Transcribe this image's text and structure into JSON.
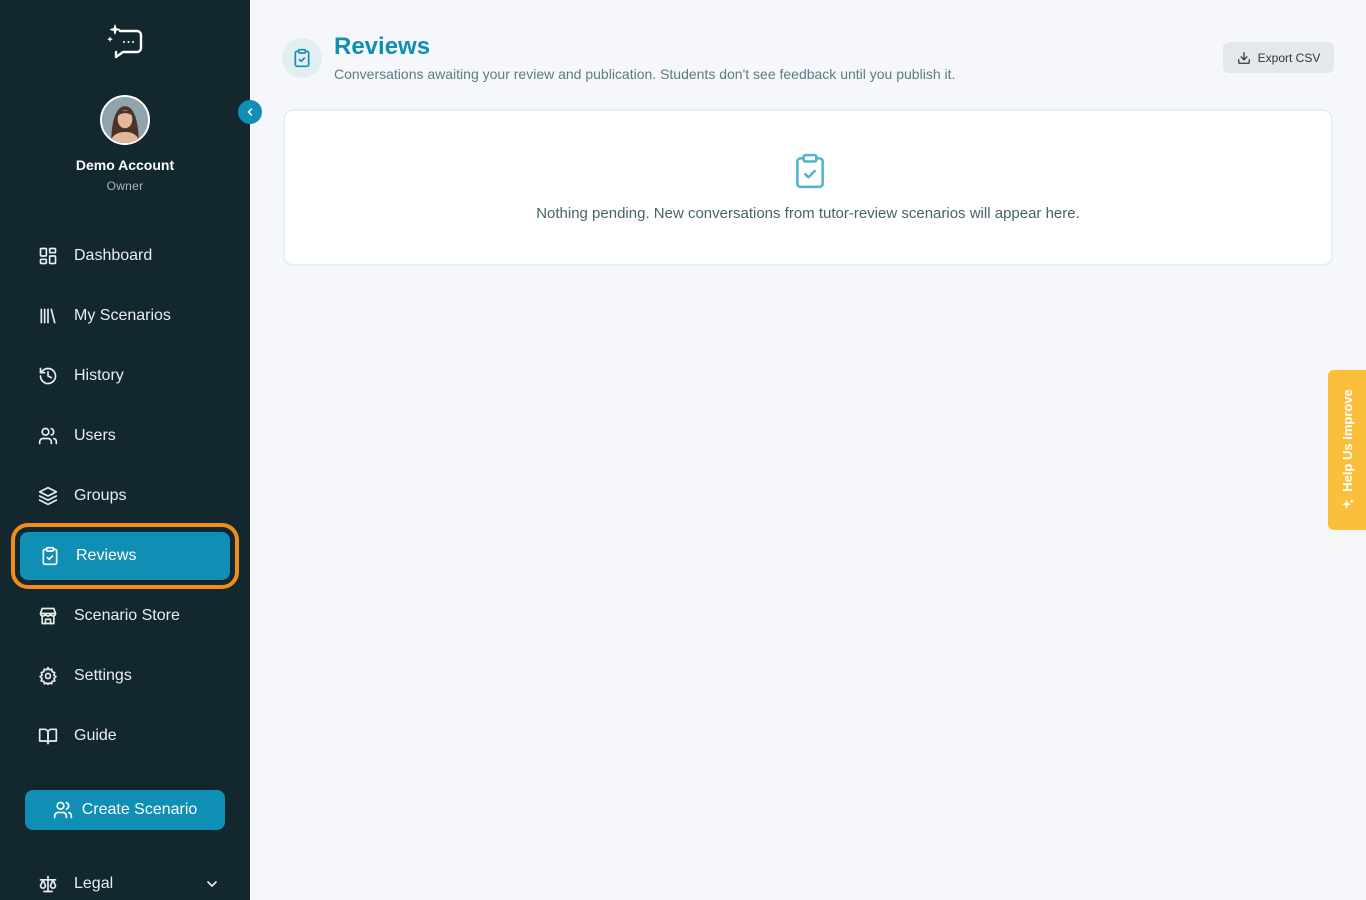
{
  "profile": {
    "name": "Demo Account",
    "role": "Owner"
  },
  "nav": {
    "dashboard": "Dashboard",
    "my_scenarios": "My Scenarios",
    "history": "History",
    "users": "Users",
    "groups": "Groups",
    "reviews": "Reviews",
    "scenario_store": "Scenario Store",
    "settings": "Settings",
    "guide": "Guide",
    "active": "reviews"
  },
  "sidebar": {
    "create_label": "Create Scenario",
    "legal_label": "Legal"
  },
  "header": {
    "title": "Reviews",
    "subtitle": "Conversations awaiting your review and publication. Students don't see feedback until you publish it.",
    "export_label": "Export CSV"
  },
  "empty_state": {
    "message": "Nothing pending. New conversations from tutor-review scenarios will appear here."
  },
  "feedback_tab": {
    "label": "Help Us Improve"
  },
  "colors": {
    "sidebar_bg": "#13282e",
    "accent": "#0f8fb3",
    "highlight": "#f08c1a",
    "feedback": "#fbbf3c"
  }
}
